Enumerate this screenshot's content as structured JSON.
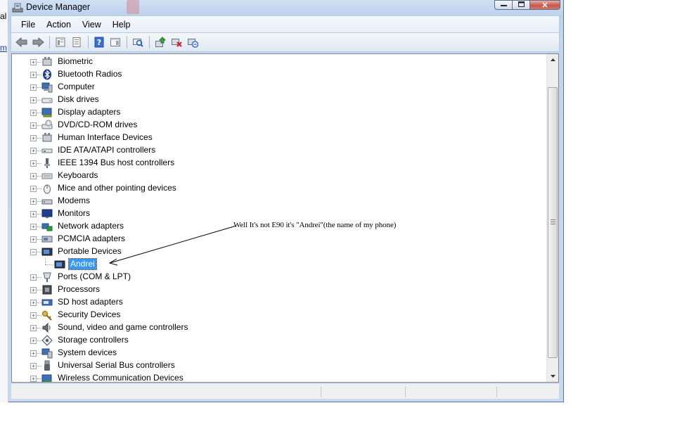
{
  "background_window": {
    "fragments": [
      "al",
      "m"
    ]
  },
  "window": {
    "title": "Device Manager",
    "caption_buttons": {
      "minimize_icon": "minimize-icon",
      "maximize_icon": "maximize-icon",
      "close_glyph": "✕"
    }
  },
  "menu": [
    "File",
    "Action",
    "View",
    "Help"
  ],
  "toolbar": {
    "buttons": [
      "back-icon",
      "forward-icon",
      "up-icon",
      "properties-icon",
      "help-icon",
      "show-hide-icon",
      "scan-hardware-icon",
      "update-driver-icon",
      "uninstall-icon",
      "disable-icon"
    ]
  },
  "tree": {
    "items": [
      {
        "label": "Biometric",
        "icon": "biometric-icon",
        "expander": "+"
      },
      {
        "label": "Bluetooth Radios",
        "icon": "bluetooth-icon",
        "expander": "+"
      },
      {
        "label": "Computer",
        "icon": "computer-icon",
        "expander": "+"
      },
      {
        "label": "Disk drives",
        "icon": "disk-drive-icon",
        "expander": "+"
      },
      {
        "label": "Display adapters",
        "icon": "display-adapter-icon",
        "expander": "+"
      },
      {
        "label": "DVD/CD-ROM drives",
        "icon": "dvd-drive-icon",
        "expander": "+"
      },
      {
        "label": "Human Interface Devices",
        "icon": "hid-icon",
        "expander": "+"
      },
      {
        "label": "IDE ATA/ATAPI controllers",
        "icon": "ide-controller-icon",
        "expander": "+"
      },
      {
        "label": "IEEE 1394 Bus host controllers",
        "icon": "firewire-icon",
        "expander": "+"
      },
      {
        "label": "Keyboards",
        "icon": "keyboard-icon",
        "expander": "+"
      },
      {
        "label": "Mice and other pointing devices",
        "icon": "mouse-icon",
        "expander": "+"
      },
      {
        "label": "Modems",
        "icon": "modem-icon",
        "expander": "+"
      },
      {
        "label": "Monitors",
        "icon": "monitor-icon",
        "expander": "+"
      },
      {
        "label": "Network adapters",
        "icon": "network-adapter-icon",
        "expander": "+"
      },
      {
        "label": "PCMCIA adapters",
        "icon": "pcmcia-icon",
        "expander": "+"
      },
      {
        "label": "Portable Devices",
        "icon": "portable-device-icon",
        "expander": "−"
      },
      {
        "label": "Andrei",
        "icon": "phone-device-icon",
        "child": true,
        "selected": true
      },
      {
        "label": "Ports (COM & LPT)",
        "icon": "port-icon",
        "expander": "+"
      },
      {
        "label": "Processors",
        "icon": "processor-icon",
        "expander": "+"
      },
      {
        "label": "SD host adapters",
        "icon": "sd-adapter-icon",
        "expander": "+"
      },
      {
        "label": "Security Devices",
        "icon": "security-device-icon",
        "expander": "+"
      },
      {
        "label": "Sound, video and game controllers",
        "icon": "sound-icon",
        "expander": "+"
      },
      {
        "label": "Storage controllers",
        "icon": "storage-controller-icon",
        "expander": "+"
      },
      {
        "label": "System devices",
        "icon": "system-device-icon",
        "expander": "+"
      },
      {
        "label": "Universal Serial Bus controllers",
        "icon": "usb-icon",
        "expander": "+"
      },
      {
        "label": "Wireless Communication Devices",
        "icon": "wireless-icon",
        "expander": "+"
      }
    ]
  },
  "annotation": {
    "text": "Well It's not E90 it's \"Andrei\"(the name of my phone)"
  },
  "colors": {
    "selection": "#3399ff",
    "frame": "#c3d6ee"
  }
}
